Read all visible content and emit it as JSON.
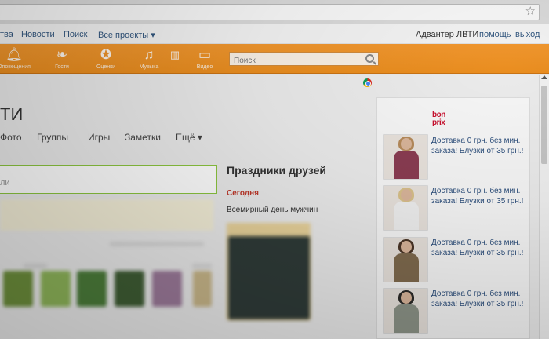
{
  "topnav": {
    "items": [
      {
        "label": "тва"
      },
      {
        "label": "Новости"
      },
      {
        "label": "Поиск"
      },
      {
        "label": "Все проекты ▾"
      }
    ],
    "user": "Адвантер ЛВТИ",
    "help": "помощь",
    "logout": "выход"
  },
  "toolbar": {
    "items": [
      {
        "label": "Оповещения",
        "icon": "bell-icon"
      },
      {
        "label": "Гости",
        "icon": "footprints-icon"
      },
      {
        "label": "Оценки",
        "icon": "rating-icon"
      },
      {
        "label": "Музыка",
        "icon": "music-icon"
      },
      {
        "label": "",
        "icon": "trash-icon"
      },
      {
        "label": "Видео",
        "icon": "video-icon"
      }
    ],
    "search_placeholder": "Поиск"
  },
  "profile": {
    "title": "ТИ",
    "subnav": [
      "Фото",
      "Группы",
      "Игры",
      "Заметки",
      "Ещё ▾"
    ],
    "post_placeholder": "ли"
  },
  "holidays": {
    "title": "Праздники друзей",
    "today_label": "Сегодня",
    "holiday_name": "Всемирный день мужчин"
  },
  "ad": {
    "brand_line1": "bon",
    "brand_line2": "prix",
    "items": [
      {
        "text": "Доставка 0 грн. без мин. заказа! Блузки от 35 грн.!"
      },
      {
        "text": "Доставка 0 грн. без мин. заказа! Блузки от 35 грн.!"
      },
      {
        "text": "Доставка 0 грн. без мин. заказа! Блузки от 35 грн.!"
      },
      {
        "text": "Доставка 0 грн. без мин. заказа! Блузки от 35 грн.!"
      }
    ]
  },
  "colors": {
    "toolbar_orange": "#ee9227",
    "link_blue": "#33577f",
    "brand_red": "#c8102e",
    "today_red": "#c0392b"
  }
}
